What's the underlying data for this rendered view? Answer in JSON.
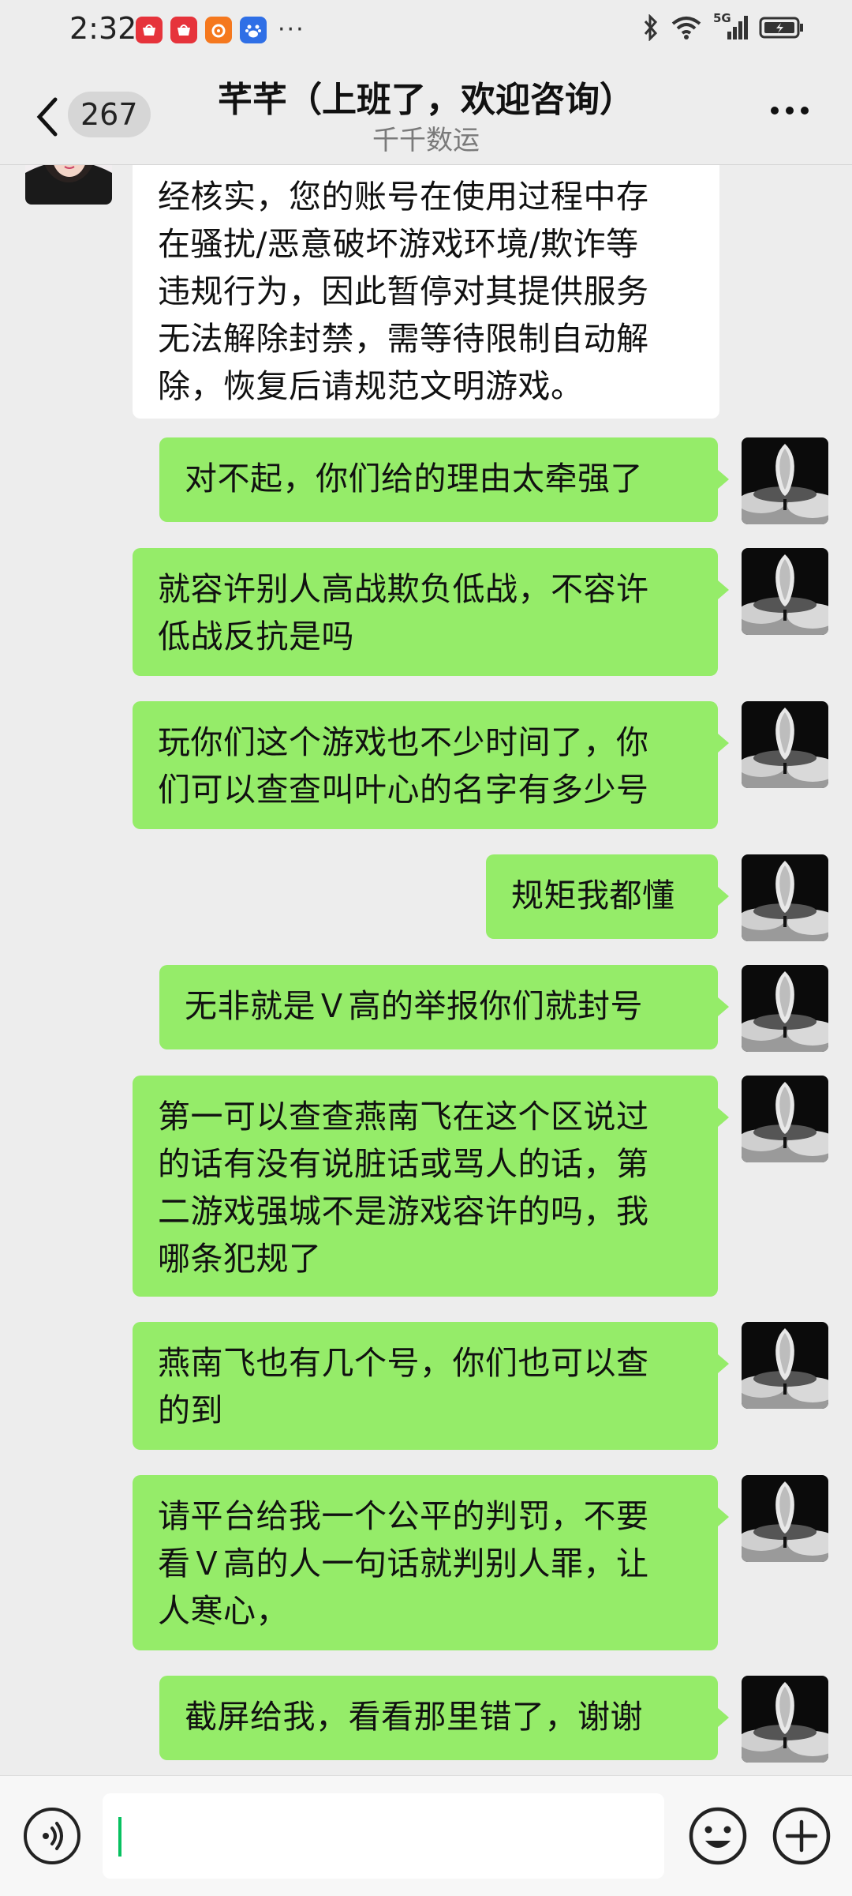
{
  "status_bar": {
    "time": "2:32",
    "app_icons": [
      "huawei-store-icon",
      "huawei-store-icon",
      "chat-icon",
      "app-orange-icon",
      "baidu-icon"
    ],
    "more": "···",
    "network": "5G",
    "icons": [
      "bluetooth-icon",
      "wifi-icon",
      "signal-icon",
      "battery-icon"
    ]
  },
  "header": {
    "back_icon": "chevron-left-icon",
    "unread_count": "267",
    "title": "芊芊（上班了，欢迎咨询）",
    "subtitle": "千千数运",
    "more_icon": "more-dots-icon"
  },
  "messages": [
    {
      "side": "left",
      "lines": [
        "经核实，您的账号在使用过程中存",
        "在骚扰/恶意破坏游戏环境/欺诈等",
        "违规行为，因此暂停对其提供服务",
        "无法解除封禁，需等待限制自动解",
        "除，恢复后请规范文明游戏。"
      ]
    },
    {
      "side": "right",
      "lines": [
        "对不起，你们给的理由太牵强了"
      ]
    },
    {
      "side": "right",
      "lines": [
        "就容许别人高战欺负低战，不容许",
        "低战反抗是吗"
      ]
    },
    {
      "side": "right",
      "lines": [
        "玩你们这个游戏也不少时间了，你",
        "们可以查查叫叶心的名字有多少号"
      ]
    },
    {
      "side": "right",
      "lines": [
        "规矩我都懂"
      ]
    },
    {
      "side": "right",
      "lines": [
        "无非就是Ｖ高的举报你们就封号"
      ]
    },
    {
      "side": "right",
      "lines": [
        "第一可以查查燕南飞在这个区说过",
        "的话有没有说脏话或骂人的话，第",
        "二游戏强城不是游戏容许的吗，我",
        "哪条犯规了"
      ]
    },
    {
      "side": "right",
      "lines": [
        "燕南飞也有几个号，你们也可以查",
        "的到"
      ]
    },
    {
      "side": "right",
      "lines": [
        "请平台给我一个公平的判罚，不要",
        "看Ｖ高的人一句话就判别人罪，让",
        "人寒心，"
      ]
    },
    {
      "side": "right",
      "lines": [
        "截屏给我，看看那里错了，谢谢"
      ]
    }
  ],
  "input_bar": {
    "voice_icon": "voice-icon",
    "input_value": "",
    "emoji_icon": "emoji-icon",
    "plus_icon": "plus-circle-icon"
  },
  "colors": {
    "background": "#ededed",
    "self_bubble": "#95ec69",
    "other_bubble": "#ffffff",
    "caret": "#07c160"
  }
}
